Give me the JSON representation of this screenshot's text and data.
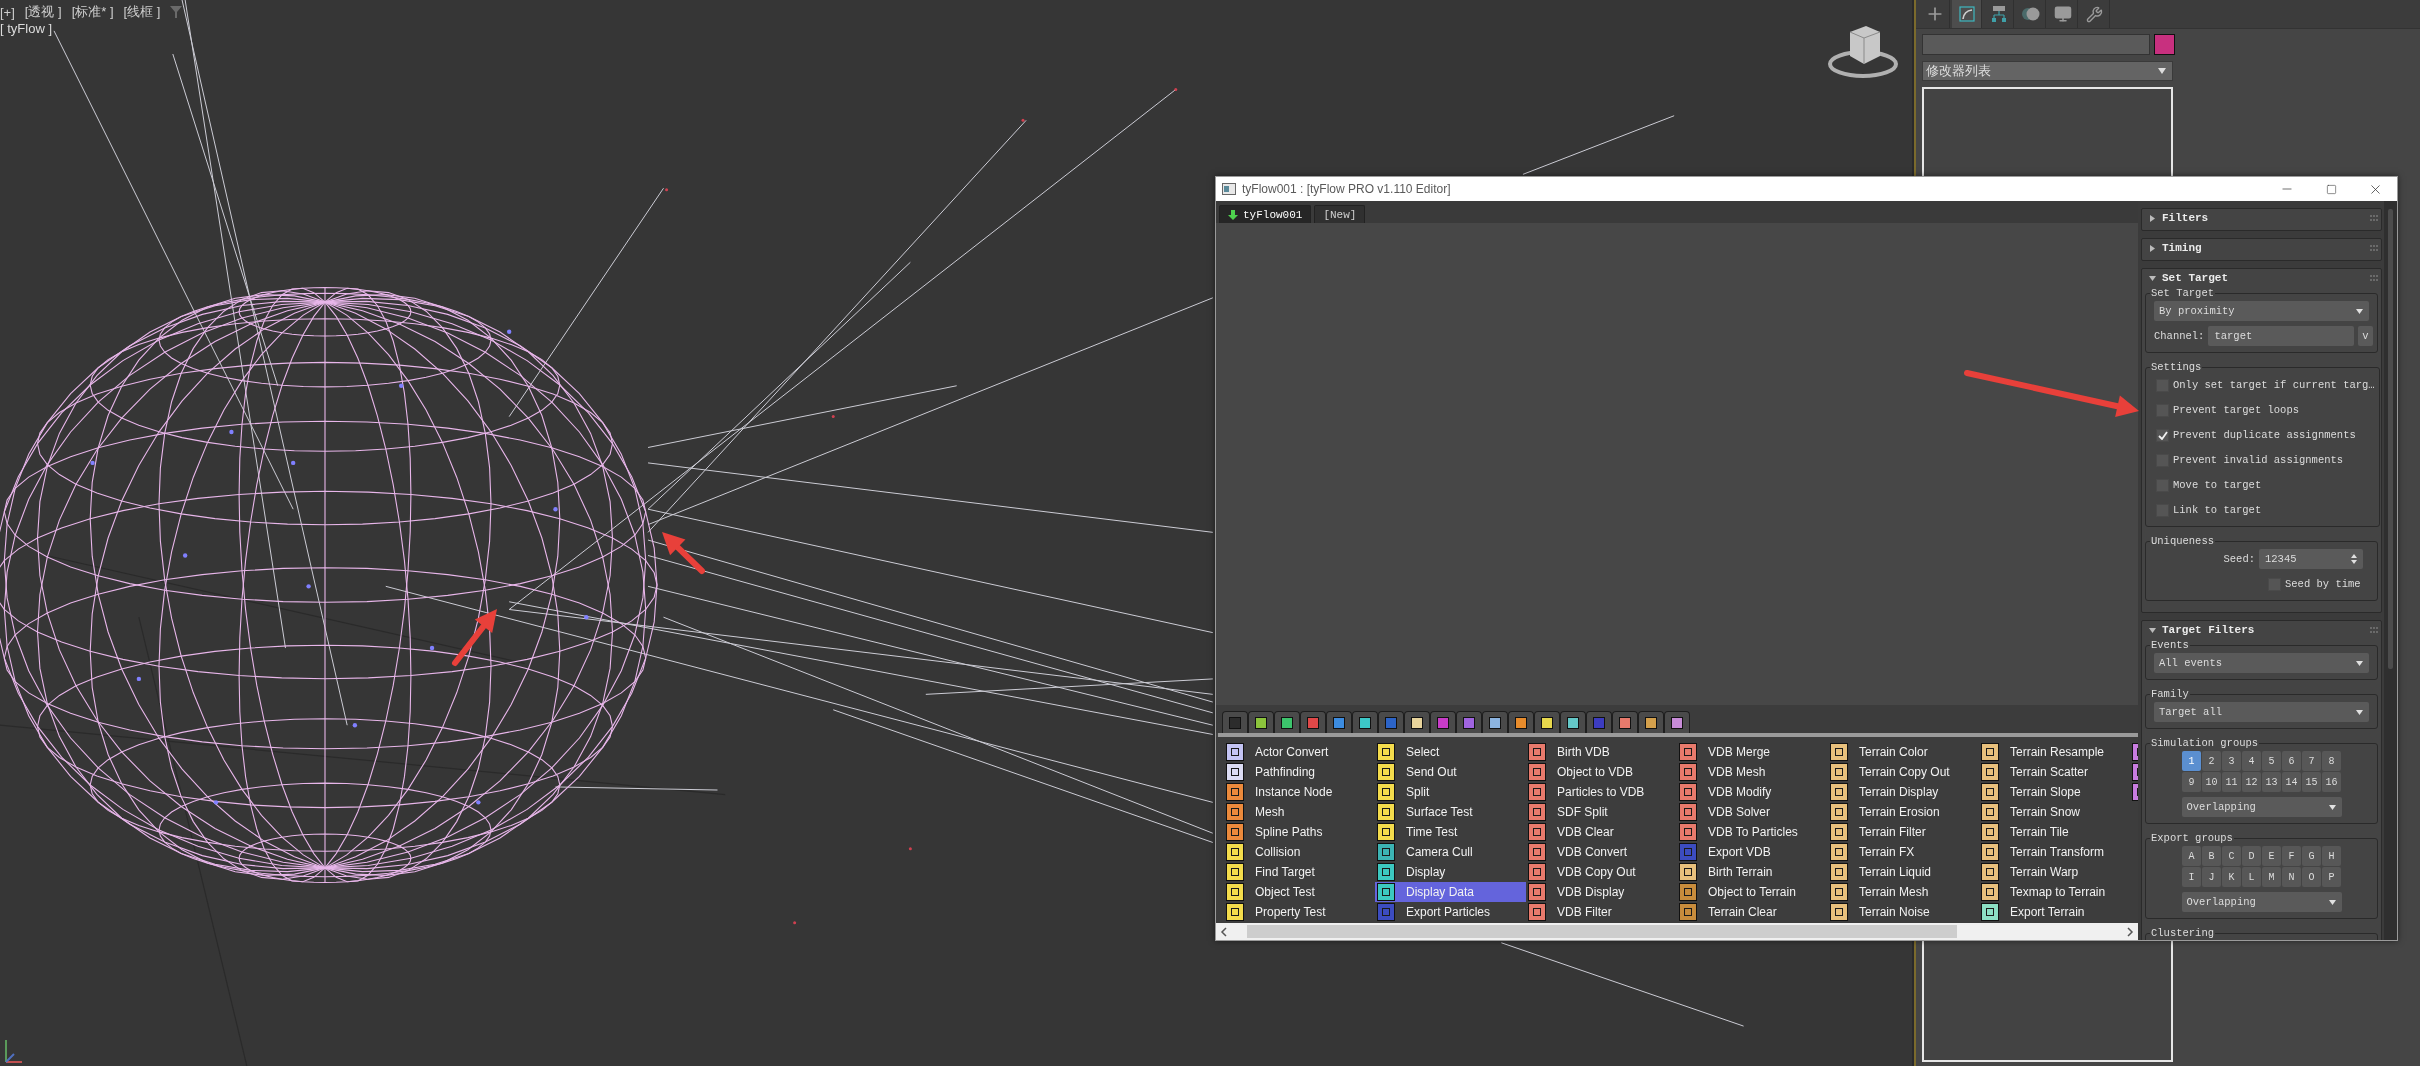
{
  "viewport": {
    "labels": [
      "[+]",
      "[透视 ]",
      "[标准* ]",
      "[线框 ]"
    ],
    "object_label": "[ tyFlow ]"
  },
  "command_panel": {
    "tabs": [
      {
        "kind": "create",
        "selected": false
      },
      {
        "kind": "modify",
        "selected": true
      },
      {
        "kind": "hierarchy",
        "selected": false
      },
      {
        "kind": "motion",
        "selected": false
      },
      {
        "kind": "display",
        "selected": false
      },
      {
        "kind": "utilities",
        "selected": false
      }
    ],
    "modifier_list": "修改器列表"
  },
  "editor": {
    "title": "tyFlow001 : [tyFlow PRO v1.110 Editor]",
    "tabs": [
      {
        "label": "tyFlow001",
        "selected": true
      },
      {
        "label": "[New]",
        "selected": false
      }
    ],
    "category_tabs": [
      {
        "color": "#2c2c2c"
      },
      {
        "color": "#8cc43c"
      },
      {
        "color": "#3cc46c"
      },
      {
        "color": "#e04848"
      },
      {
        "color": "#3c8ce0"
      },
      {
        "color": "#3cc8c8"
      },
      {
        "color": "#2c64c8"
      },
      {
        "color": "#e8d49c"
      },
      {
        "color": "#c83cc8"
      },
      {
        "color": "#a064e0"
      },
      {
        "color": "#8cb4e0"
      },
      {
        "color": "#e88c2c"
      },
      {
        "color": "#e8d84c"
      },
      {
        "color": "#64c8c8"
      },
      {
        "color": "#3c3cc0"
      },
      {
        "color": "#e87a6c"
      },
      {
        "color": "#d4a04c"
      },
      {
        "color": "#c88cd8"
      }
    ],
    "operator_columns": [
      {
        "items": [
          {
            "label": "Actor Convert",
            "color": "#c4c4f4",
            "selected": false
          },
          {
            "label": "Pathfinding",
            "color": "#dcdcf4",
            "selected": false
          },
          {
            "label": "Instance Node",
            "color": "#ec8a3c",
            "selected": false
          },
          {
            "label": "Mesh",
            "color": "#ec8a3c",
            "selected": false
          },
          {
            "label": "Spline Paths",
            "color": "#ec8a3c",
            "selected": false
          },
          {
            "label": "Collision",
            "color": "#f4dc4c",
            "selected": false
          },
          {
            "label": "Find Target",
            "color": "#f4dc4c",
            "selected": false
          },
          {
            "label": "Object Test",
            "color": "#f4dc4c",
            "selected": false
          },
          {
            "label": "Property Test",
            "color": "#f4dc4c",
            "selected": false
          }
        ]
      },
      {
        "items": [
          {
            "label": "Select",
            "color": "#f4dc4c",
            "selected": false
          },
          {
            "label": "Send Out",
            "color": "#f4dc4c",
            "selected": false
          },
          {
            "label": "Split",
            "color": "#f4dc4c",
            "selected": false
          },
          {
            "label": "Surface Test",
            "color": "#f4dc4c",
            "selected": false
          },
          {
            "label": "Time Test",
            "color": "#f4dc4c",
            "selected": false
          },
          {
            "label": "Camera Cull",
            "color": "#3cb4b4",
            "selected": false
          },
          {
            "label": "Display",
            "color": "#3cc8c0",
            "selected": false
          },
          {
            "label": "Display Data",
            "color": "#3cc8c0",
            "selected": true
          },
          {
            "label": "Export Particles",
            "color": "#3c4cc0",
            "selected": false
          }
        ]
      },
      {
        "items": [
          {
            "label": "Birth VDB",
            "color": "#e87a6c",
            "selected": false
          },
          {
            "label": "Object to VDB",
            "color": "#e87a6c",
            "selected": false
          },
          {
            "label": "Particles to VDB",
            "color": "#e87a6c",
            "selected": false
          },
          {
            "label": "SDF Split",
            "color": "#e87a6c",
            "selected": false
          },
          {
            "label": "VDB Clear",
            "color": "#e87a6c",
            "selected": false
          },
          {
            "label": "VDB Convert",
            "color": "#e87a6c",
            "selected": false
          },
          {
            "label": "VDB Copy Out",
            "color": "#e87a6c",
            "selected": false
          },
          {
            "label": "VDB Display",
            "color": "#e87a6c",
            "selected": false
          },
          {
            "label": "VDB Filter",
            "color": "#e87a6c",
            "selected": false
          }
        ]
      },
      {
        "items": [
          {
            "label": "VDB Merge",
            "color": "#e87a6c",
            "selected": false
          },
          {
            "label": "VDB Mesh",
            "color": "#e87a6c",
            "selected": false
          },
          {
            "label": "VDB Modify",
            "color": "#e87a6c",
            "selected": false
          },
          {
            "label": "VDB Solver",
            "color": "#e87a6c",
            "selected": false
          },
          {
            "label": "VDB To Particles",
            "color": "#e87a6c",
            "selected": false
          },
          {
            "label": "Export VDB",
            "color": "#3c4cc0",
            "selected": false
          },
          {
            "label": "Birth Terrain",
            "color": "#e8c07c",
            "selected": false
          },
          {
            "label": "Object to Terrain",
            "color": "#c88c3c",
            "selected": false
          },
          {
            "label": "Terrain Clear",
            "color": "#c88c3c",
            "selected": false
          }
        ]
      },
      {
        "items": [
          {
            "label": "Terrain Color",
            "color": "#e8c07c",
            "selected": false
          },
          {
            "label": "Terrain Copy Out",
            "color": "#e8c07c",
            "selected": false
          },
          {
            "label": "Terrain Display",
            "color": "#e8c07c",
            "selected": false
          },
          {
            "label": "Terrain Erosion",
            "color": "#e8c07c",
            "selected": false
          },
          {
            "label": "Terrain Filter",
            "color": "#e8c07c",
            "selected": false
          },
          {
            "label": "Terrain FX",
            "color": "#e8c07c",
            "selected": false
          },
          {
            "label": "Terrain Liquid",
            "color": "#e8c07c",
            "selected": false
          },
          {
            "label": "Terrain Mesh",
            "color": "#e8c07c",
            "selected": false
          },
          {
            "label": "Terrain Noise",
            "color": "#e8c07c",
            "selected": false
          }
        ]
      },
      {
        "items": [
          {
            "label": "Terrain Resample",
            "color": "#e8c07c",
            "selected": false
          },
          {
            "label": "Terrain Scatter",
            "color": "#e8c07c",
            "selected": false
          },
          {
            "label": "Terrain Slope",
            "color": "#e8c07c",
            "selected": false
          },
          {
            "label": "Terrain Snow",
            "color": "#e8c07c",
            "selected": false
          },
          {
            "label": "Terrain Tile",
            "color": "#e8c07c",
            "selected": false
          },
          {
            "label": "Terrain Transform",
            "color": "#e8c07c",
            "selected": false
          },
          {
            "label": "Terrain Warp",
            "color": "#e8c07c",
            "selected": false
          },
          {
            "label": "Texmap to Terrain",
            "color": "#e8c07c",
            "selected": false
          },
          {
            "label": "Export Terrain",
            "color": "#8ce0c4",
            "selected": false
          }
        ]
      }
    ],
    "cut_off_icons": [
      {
        "color": "#c87ce0"
      },
      {
        "color": "#c87ce0"
      },
      {
        "color": "#c87ce0"
      }
    ],
    "rollouts": [
      {
        "title": "Filters",
        "expanded": false
      },
      {
        "title": "Timing",
        "expanded": false
      },
      {
        "title": "Set Target",
        "expanded": true,
        "groups": [
          {
            "title": "Set Target",
            "controls": [
              {
                "kind": "dropdown",
                "value": "By proximity"
              },
              {
                "kind": "channel",
                "label": "Channel:",
                "value": "target",
                "button": "v"
              }
            ]
          },
          {
            "title": "Settings",
            "controls": [
              {
                "kind": "checkbox",
                "label": "Only set target if current targ…",
                "checked": false
              },
              {
                "kind": "checkbox",
                "label": "Prevent target loops",
                "checked": false
              },
              {
                "kind": "checkbox",
                "label": "Prevent duplicate assignments",
                "checked": true
              },
              {
                "kind": "checkbox",
                "label": "Prevent invalid assignments",
                "checked": false
              },
              {
                "kind": "checkbox",
                "label": "Move to target",
                "checked": false
              },
              {
                "kind": "checkbox",
                "label": "Link to target",
                "checked": false
              }
            ]
          },
          {
            "title": "Uniqueness",
            "controls": [
              {
                "kind": "spinner",
                "label": "Seed:",
                "value": "12345"
              },
              {
                "kind": "checkbox_right",
                "label": "Seed by time",
                "checked": false
              }
            ]
          }
        ]
      },
      {
        "title": "Target Filters",
        "expanded": true,
        "groups": [
          {
            "title": "Events",
            "controls": [
              {
                "kind": "dropdown",
                "value": "All events"
              }
            ]
          },
          {
            "title": "Family",
            "controls": [
              {
                "kind": "dropdown",
                "value": "Target all"
              }
            ]
          },
          {
            "title": "Simulation groups",
            "controls": [
              {
                "kind": "buttons",
                "buttons": [
                  {
                    "label": "1",
                    "selected": true
                  },
                  {
                    "label": "2",
                    "selected": false
                  },
                  {
                    "label": "3",
                    "selected": false
                  },
                  {
                    "label": "4",
                    "selected": false
                  },
                  {
                    "label": "5",
                    "selected": false
                  },
                  {
                    "label": "6",
                    "selected": false
                  },
                  {
                    "label": "7",
                    "selected": false
                  },
                  {
                    "label": "8",
                    "selected": false
                  },
                  {
                    "label": "9",
                    "selected": false
                  },
                  {
                    "label": "10",
                    "selected": false
                  },
                  {
                    "label": "11",
                    "selected": false
                  },
                  {
                    "label": "12",
                    "selected": false
                  },
                  {
                    "label": "13",
                    "selected": false
                  },
                  {
                    "label": "14",
                    "selected": false
                  },
                  {
                    "label": "15",
                    "selected": false
                  },
                  {
                    "label": "16",
                    "selected": false
                  }
                ]
              },
              {
                "kind": "small_dropdown",
                "value": "Overlapping"
              }
            ]
          },
          {
            "title": "Export groups",
            "controls": [
              {
                "kind": "buttons",
                "buttons": [
                  {
                    "label": "A",
                    "selected": false
                  },
                  {
                    "label": "B",
                    "selected": false
                  },
                  {
                    "label": "C",
                    "selected": false
                  },
                  {
                    "label": "D",
                    "selected": false
                  },
                  {
                    "label": "E",
                    "selected": false
                  },
                  {
                    "label": "F",
                    "selected": false
                  },
                  {
                    "label": "G",
                    "selected": false
                  },
                  {
                    "label": "H",
                    "selected": false
                  },
                  {
                    "label": "I",
                    "selected": false
                  },
                  {
                    "label": "J",
                    "selected": false
                  },
                  {
                    "label": "K",
                    "selected": false
                  },
                  {
                    "label": "L",
                    "selected": false
                  },
                  {
                    "label": "M",
                    "selected": false
                  },
                  {
                    "label": "N",
                    "selected": false
                  },
                  {
                    "label": "O",
                    "selected": false
                  },
                  {
                    "label": "P",
                    "selected": false
                  }
                ]
              },
              {
                "kind": "small_dropdown",
                "value": "Overlapping"
              }
            ]
          },
          {
            "title": "Clustering"
          }
        ]
      }
    ]
  }
}
